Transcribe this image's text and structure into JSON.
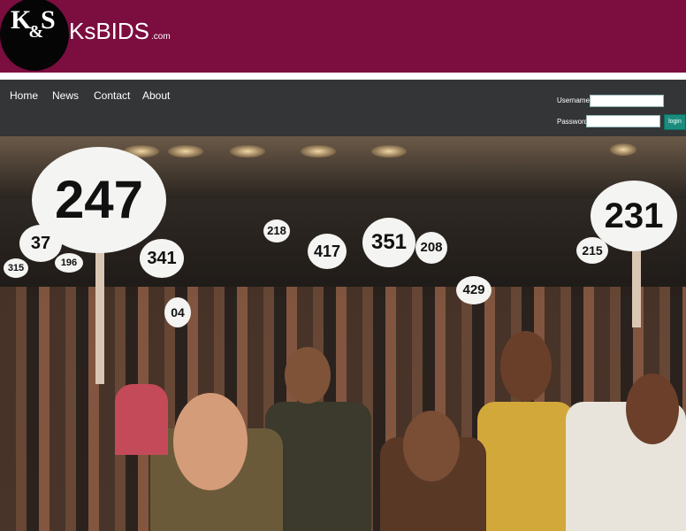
{
  "header": {
    "logo_text": "K&S",
    "brand": "KsBIDS",
    "brand_tld": ".com"
  },
  "nav": {
    "items": [
      {
        "label": "Home"
      },
      {
        "label": "News"
      },
      {
        "label": "Contact"
      },
      {
        "label": "About"
      }
    ]
  },
  "login": {
    "username_label": "Username:",
    "password_label": "Password:",
    "username_value": "",
    "password_value": "",
    "button_label": "login"
  },
  "hero": {
    "paddles": [
      "247",
      "231",
      "37",
      "341",
      "218",
      "417",
      "351",
      "208",
      "429",
      "215",
      "315",
      "04",
      "196"
    ]
  },
  "colors": {
    "header_bg": "#7b0d3f",
    "nav_bg": "#333536",
    "login_button": "#1a8c7e"
  }
}
